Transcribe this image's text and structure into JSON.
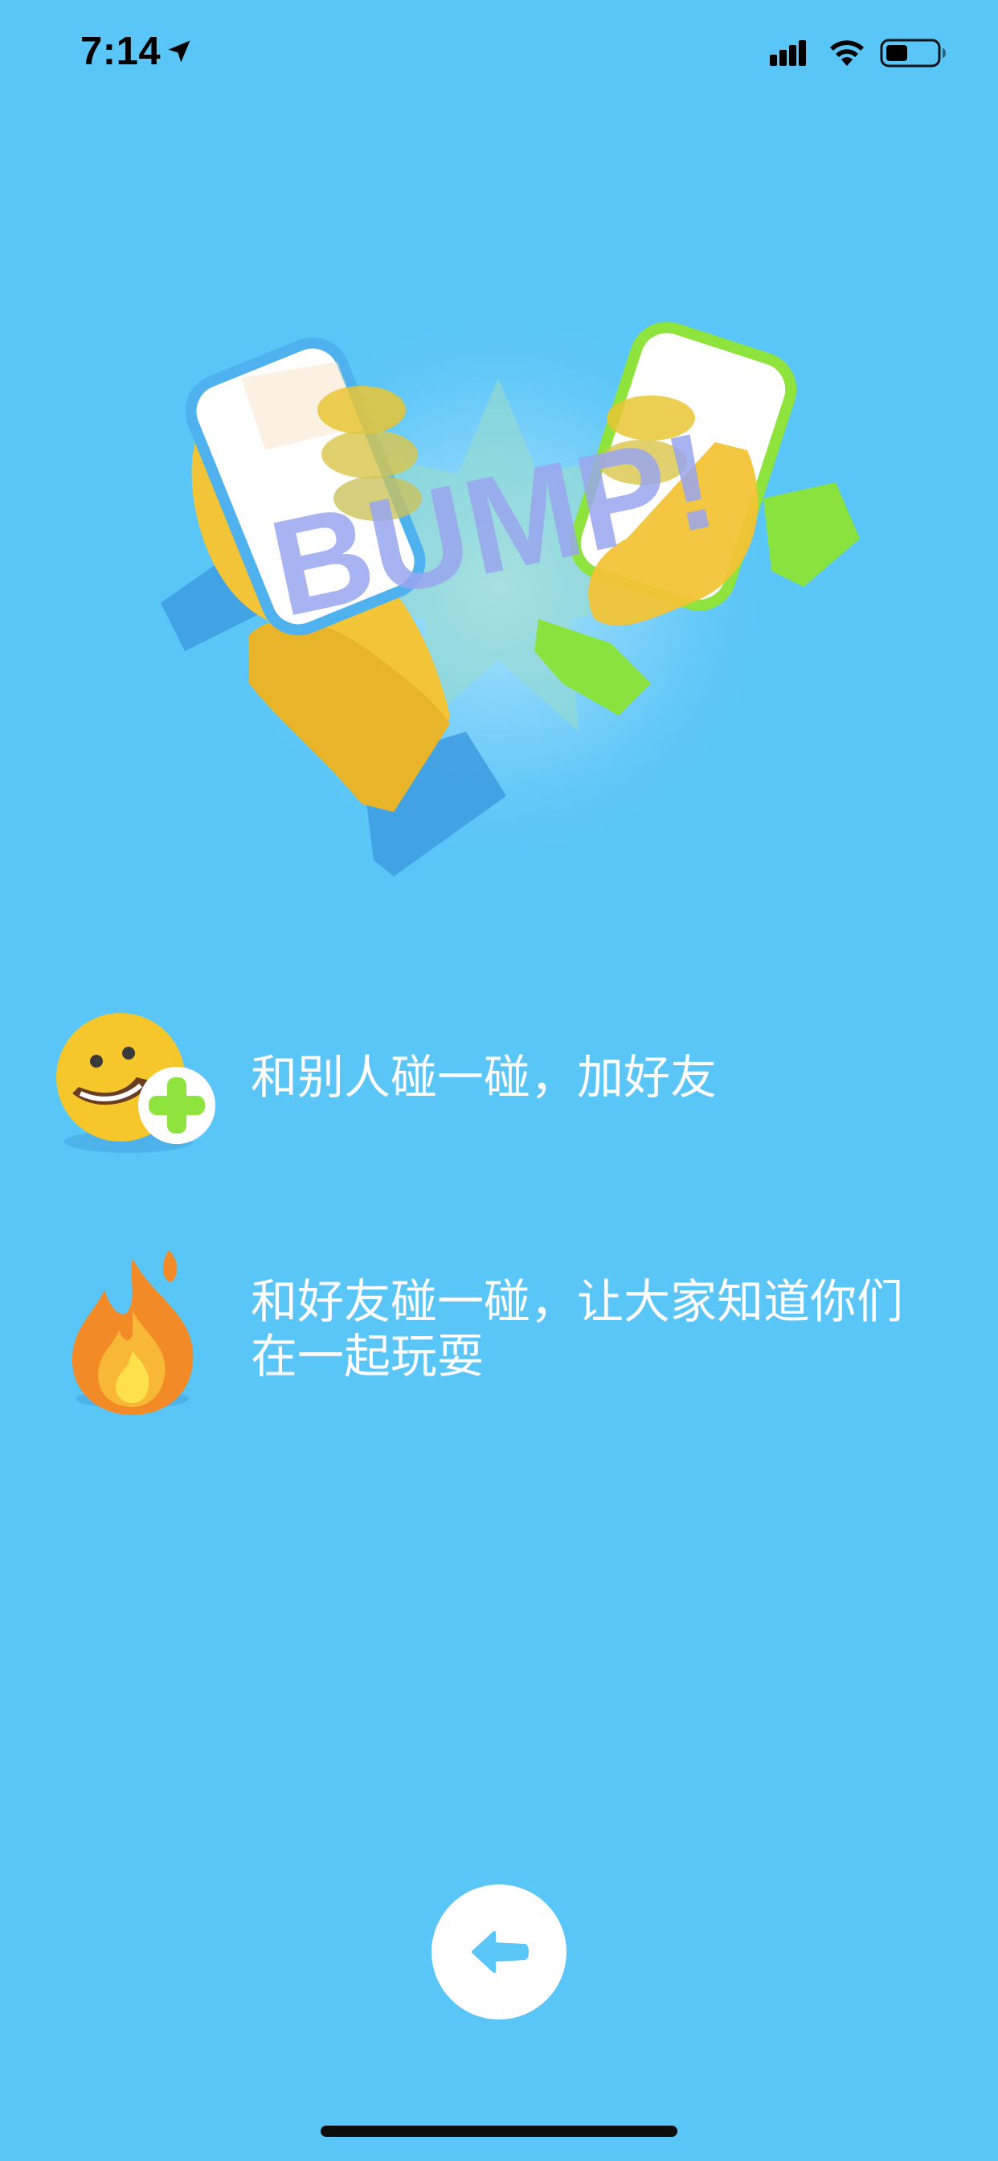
{
  "status_bar": {
    "time": "7:14",
    "location_icon": "location-arrow-icon",
    "signal_icon": "cellular-signal-icon",
    "wifi_icon": "wifi-icon",
    "battery_icon": "battery-icon",
    "battery_level": 0.4
  },
  "hero": {
    "illustration": "hands-bumping-phones-illustration",
    "logo_text": "BUMP!"
  },
  "features": [
    {
      "icon": "smiley-plus-icon",
      "text": "和别人碰一碰，加好友"
    },
    {
      "icon": "fire-icon",
      "text_line1": "和好友碰一碰，让大家知道你们",
      "text_line2": "在一起玩耍"
    }
  ],
  "navigation": {
    "back_icon": "arrow-left-icon"
  },
  "colors": {
    "background": "#5ac5f7",
    "button": "#ffffff",
    "button_icon": "#5ac5f7",
    "text": "#ffffff"
  }
}
